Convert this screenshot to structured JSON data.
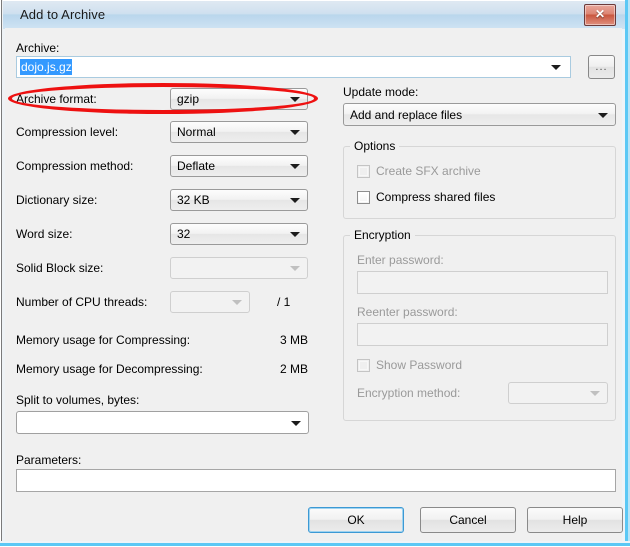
{
  "window": {
    "title": "Add to Archive",
    "close_label": "✕"
  },
  "archive": {
    "label": "Archive:",
    "value": "dojo.js.gz",
    "browse_label": "..."
  },
  "settings": {
    "archive_format": {
      "label": "Archive format:",
      "value": "gzip"
    },
    "compression_level": {
      "label": "Compression level:",
      "value": "Normal"
    },
    "compression_method": {
      "label": "Compression method:",
      "value": "Deflate"
    },
    "dictionary_size": {
      "label": "Dictionary size:",
      "value": "32 KB"
    },
    "word_size": {
      "label": "Word size:",
      "value": "32"
    },
    "solid_block_size": {
      "label": "Solid Block size:",
      "value": ""
    },
    "cpu_threads": {
      "label": "Number of CPU threads:",
      "value": "",
      "total": "/ 1"
    },
    "memory_compress": {
      "label": "Memory usage for Compressing:",
      "value": "3 MB"
    },
    "memory_decompress": {
      "label": "Memory usage for Decompressing:",
      "value": "2 MB"
    },
    "split_volumes": {
      "label": "Split to volumes, bytes:",
      "value": ""
    },
    "parameters": {
      "label": "Parameters:",
      "value": ""
    }
  },
  "update_mode": {
    "label": "Update mode:",
    "value": "Add and replace files"
  },
  "options": {
    "title": "Options",
    "create_sfx": {
      "label": "Create SFX archive",
      "checked": false,
      "disabled": true
    },
    "compress_shared": {
      "label": "Compress shared files",
      "checked": false,
      "disabled": false
    }
  },
  "encryption": {
    "title": "Encryption",
    "enter_password_label": "Enter password:",
    "enter_password_value": "",
    "reenter_password_label": "Reenter password:",
    "reenter_password_value": "",
    "show_password_label": "Show Password",
    "method_label": "Encryption method:",
    "method_value": ""
  },
  "buttons": {
    "ok": "OK",
    "cancel": "Cancel",
    "help": "Help"
  },
  "annotation": {
    "color": "#ee1111"
  }
}
